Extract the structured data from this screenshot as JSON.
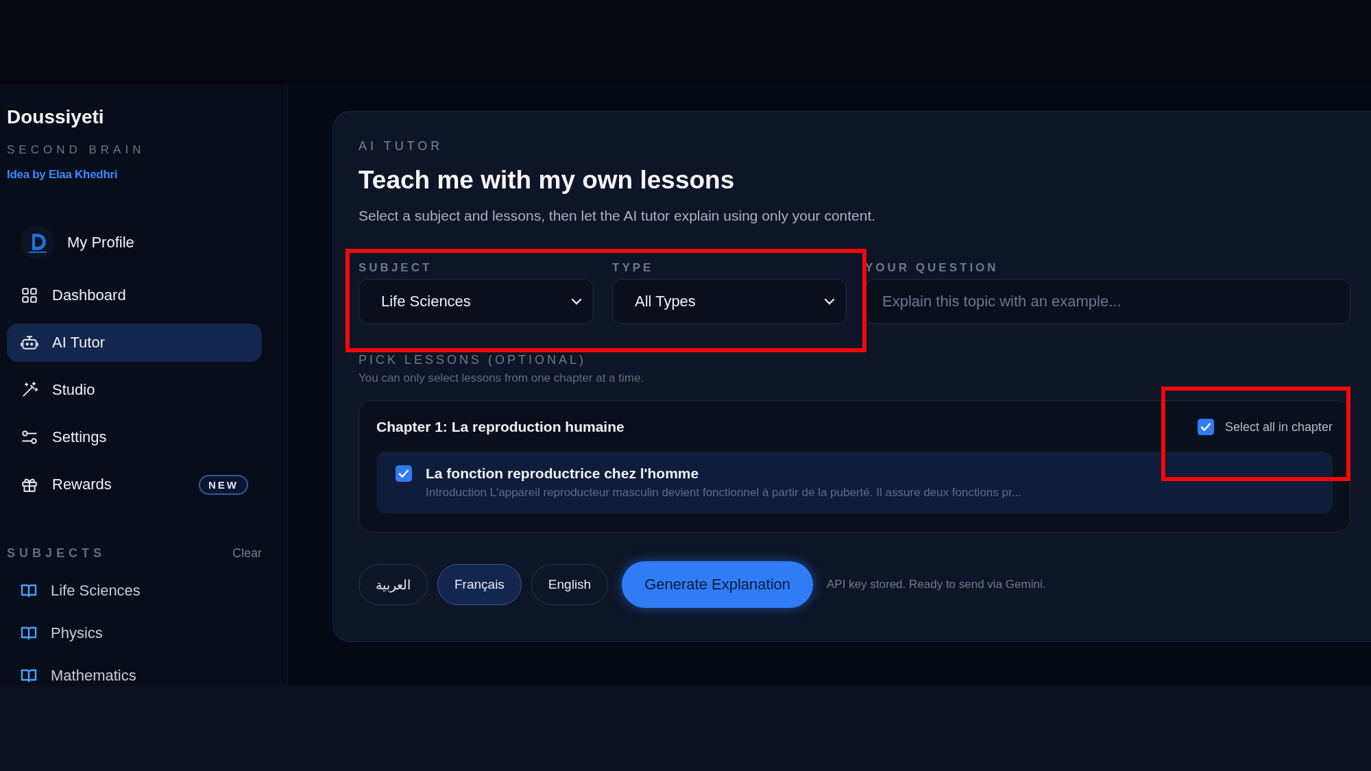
{
  "sidebar": {
    "brand": "Doussiyeti",
    "tagline": "SECOND BRAIN",
    "credit": "Idea by Elaa Khedhri",
    "profile": {
      "label": "My Profile"
    },
    "nav": [
      {
        "label": "Dashboard",
        "selected": false
      },
      {
        "label": "AI Tutor",
        "selected": true
      },
      {
        "label": "Studio",
        "selected": false
      },
      {
        "label": "Settings",
        "selected": false
      },
      {
        "label": "Rewards",
        "selected": false,
        "badge": "NEW"
      }
    ],
    "subjects_heading": "SUBJECTS",
    "clear": "Clear",
    "subjects": [
      {
        "label": "Life Sciences"
      },
      {
        "label": "Physics"
      },
      {
        "label": "Mathematics"
      }
    ]
  },
  "tutor": {
    "eyebrow": "AI TUTOR",
    "title": "Teach me with my own lessons",
    "subtitle": "Select a subject and lessons, then let the AI tutor explain using only your content.",
    "subject": {
      "label": "SUBJECT",
      "value": "Life Sciences"
    },
    "type": {
      "label": "TYPE",
      "value": "All Types"
    },
    "question": {
      "label": "YOUR QUESTION",
      "placeholder": "Explain this topic with an example..."
    },
    "lessons_heading": "PICK LESSONS (OPTIONAL)",
    "lessons_note": "You can only select lessons from one chapter at a time.",
    "chapter": {
      "title": "Chapter 1: La reproduction humaine",
      "select_all": {
        "label": "Select all in chapter",
        "checked": true
      },
      "lessons": [
        {
          "title": "La fonction reproductrice chez l'homme",
          "excerpt": "Introduction L'appareil reproducteur masculin devient fonctionnel à partir de la puberté. Il assure deux fonctions pr...",
          "checked": true
        }
      ]
    },
    "languages": [
      {
        "label": "العربية",
        "selected": false
      },
      {
        "label": "Français",
        "selected": true
      },
      {
        "label": "English",
        "selected": false
      }
    ],
    "generate": "Generate Explanation",
    "status": "API key stored. Ready to send via Gemini."
  }
}
